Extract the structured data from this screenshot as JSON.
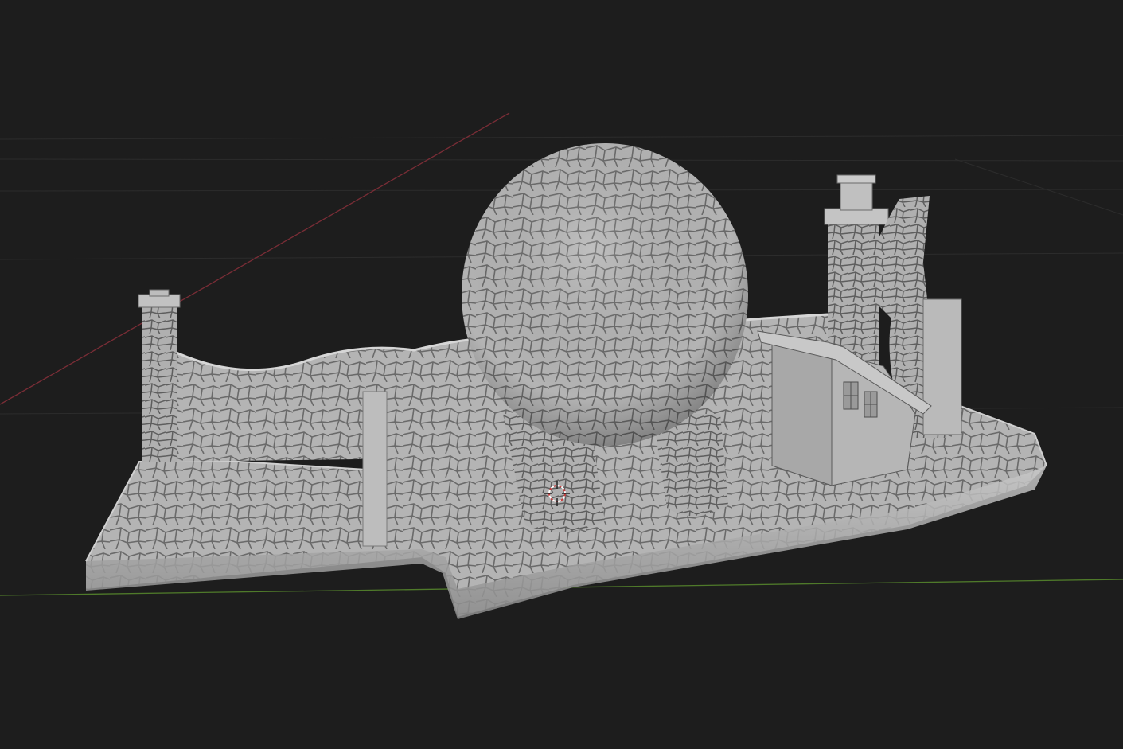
{
  "viewport": {
    "background": "#1d1d1d",
    "grid_color": "#2c2c2c",
    "x_axis_color": "#7a2d36",
    "y_axis_color": "#4f7a2a",
    "mode": "3d-viewport"
  },
  "scene": {
    "object_color": "#b4b4b4",
    "shade_dark": "#7c7c7c",
    "crack_color": "#5e5e5e",
    "objects": [
      "stone-base-slab",
      "back-wall",
      "left-pillar",
      "front-wall-segment",
      "stone-egg-dome",
      "stone-leg-left",
      "stone-leg-right",
      "small-house",
      "chimney-tower",
      "curved-tower"
    ]
  },
  "cursor": {
    "icon": "3d-cursor-icon",
    "colors": [
      "#c83c3c",
      "#ffffff"
    ]
  }
}
